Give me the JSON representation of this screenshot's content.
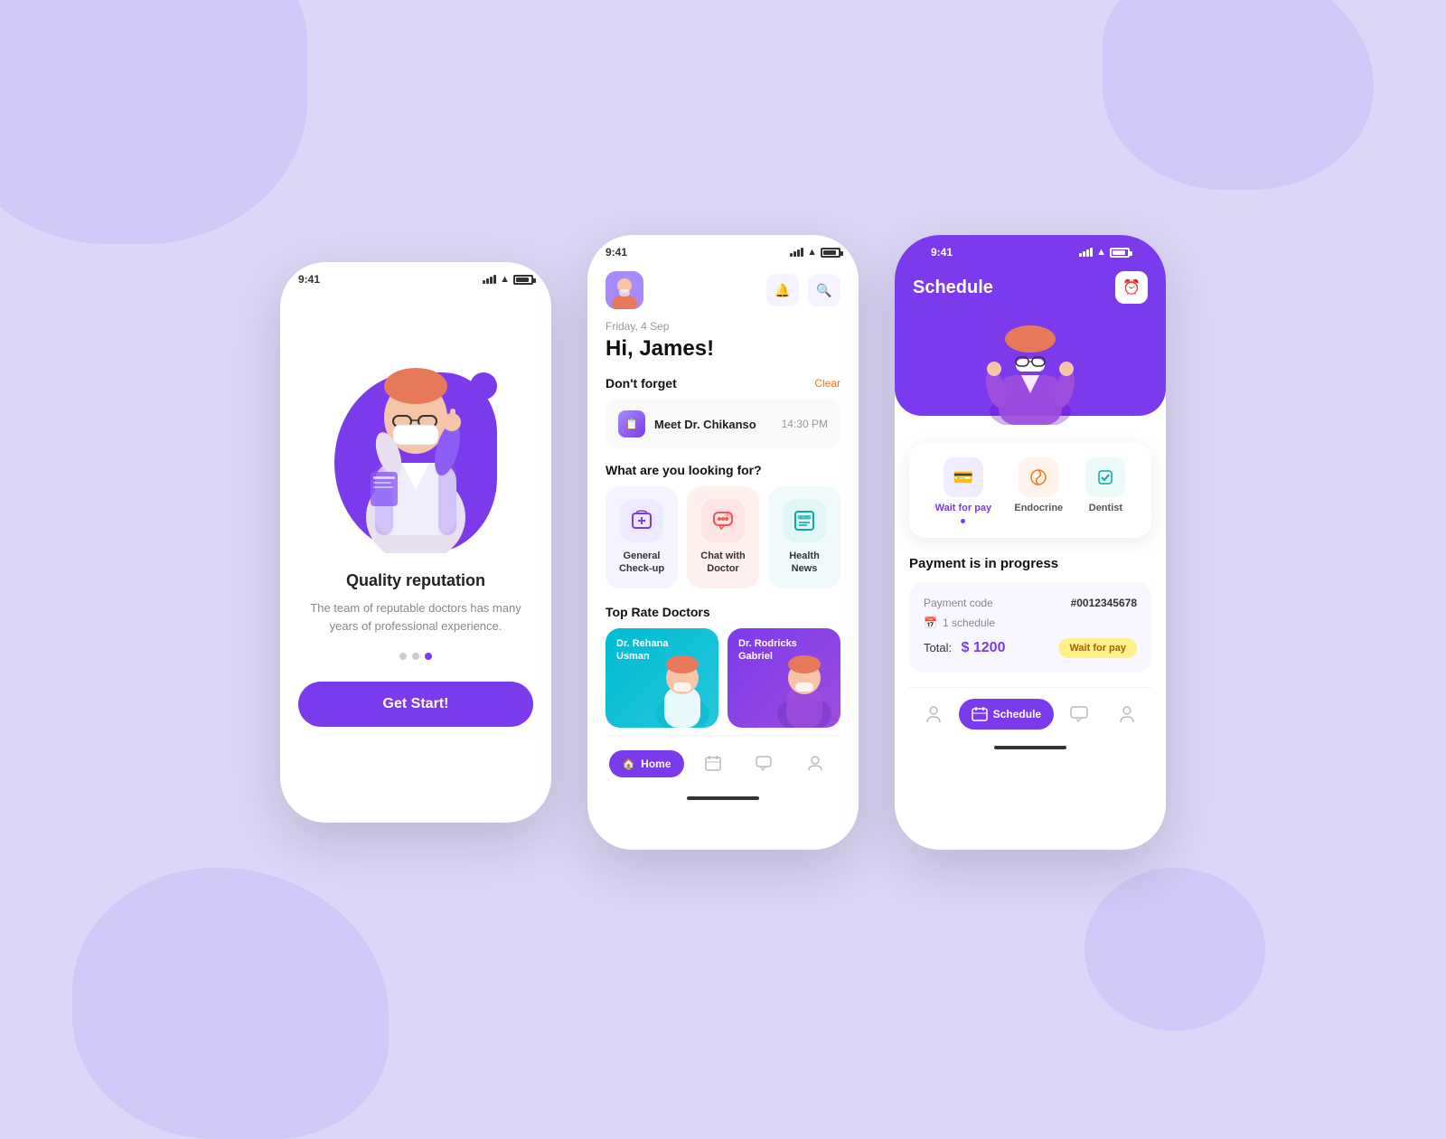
{
  "background": {
    "color": "#dcd6f7"
  },
  "phone1": {
    "status_time": "9:41",
    "title": "Quality reputation",
    "description": "The team of reputable doctors has many years of professional experience.",
    "button_label": "Get Start!",
    "dots": [
      "inactive",
      "inactive",
      "active"
    ]
  },
  "phone2": {
    "status_time": "9:41",
    "date_label": "Friday, 4 Sep",
    "greeting": "Hi, James!",
    "dont_forget_label": "Don't forget",
    "clear_label": "Clear",
    "reminder": {
      "name": "Meet Dr. Chikanso",
      "time": "14:30 PM"
    },
    "looking_for_label": "What are you looking for?",
    "actions": [
      {
        "label": "General Check-up",
        "icon": "🏥",
        "bg": "purple"
      },
      {
        "label": "Chat with Doctor",
        "icon": "💬",
        "bg": "pink"
      },
      {
        "label": "Health News",
        "icon": "📰",
        "bg": "teal"
      }
    ],
    "top_doctors_label": "Top Rate Doctors",
    "doctors": [
      {
        "name": "Dr. Rehana Usman",
        "color": "cyan"
      },
      {
        "name": "Dr. Rodricks Gabriel",
        "color": "purple"
      }
    ],
    "nav": [
      {
        "label": "Home",
        "icon": "🏠",
        "active": true
      },
      {
        "label": "Calendar",
        "icon": "📅",
        "active": false
      },
      {
        "label": "Chat",
        "icon": "💬",
        "active": false
      },
      {
        "label": "Profile",
        "icon": "👤",
        "active": false
      }
    ]
  },
  "phone3": {
    "status_time": "9:41",
    "title": "Schedule",
    "services": [
      {
        "label": "Wait for pay",
        "icon": "💳",
        "active": true
      },
      {
        "label": "Endocrine",
        "icon": "🔄",
        "active": false
      },
      {
        "label": "Dentist",
        "icon": "✅",
        "active": false
      }
    ],
    "payment_progress_label": "Payment is in progress",
    "payment": {
      "code_label": "Payment code",
      "code_value": "#0012345678",
      "schedule_label": "1 schedule",
      "total_label": "Total:",
      "total_amount": "$ 1200",
      "status_badge": "Wait for pay"
    },
    "nav": [
      {
        "label": "Profile",
        "icon": "👤",
        "active": false
      },
      {
        "label": "Schedule",
        "icon": "📅",
        "active": true
      },
      {
        "label": "Chat",
        "icon": "💬",
        "active": false
      },
      {
        "label": "User",
        "icon": "🧑",
        "active": false
      }
    ]
  }
}
